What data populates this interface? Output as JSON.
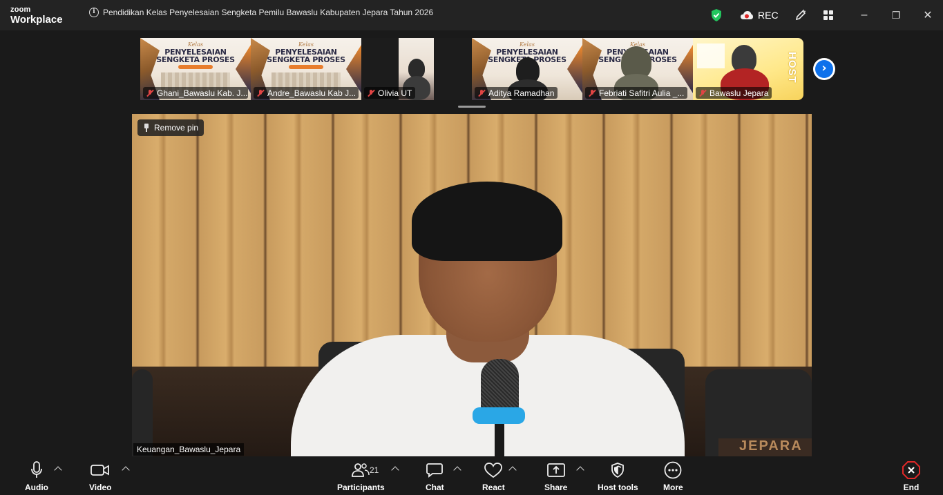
{
  "app": {
    "logo_line1": "zoom",
    "logo_line2": "Workplace"
  },
  "window": {
    "title": "Pendidikan Kelas Penyelesaian Sengketa Pemilu Bawaslu Kabupaten Jepara Tahun 2026"
  },
  "titlebar": {
    "security_icon": "shield-check-icon",
    "rec_label": "REC",
    "minimize": "–",
    "restore": "❐",
    "close": "✕"
  },
  "slide": {
    "kelas": "Kelas",
    "title_line1": "PENYELESAIAN",
    "title_line2": "SENGKETA PROSES"
  },
  "thumbnails": [
    {
      "name": "Ghani_Bawaslu Kab. J...",
      "muted": true
    },
    {
      "name": "Andre_Bawaslu Kab J...",
      "muted": true
    },
    {
      "name": "Olivia UT",
      "muted": true
    },
    {
      "name": "Aditya Ramadhan",
      "muted": true
    },
    {
      "name": "Febriati Safitri Aulia _...",
      "muted": true
    },
    {
      "name": "Bawaslu Jepara",
      "muted": true,
      "badge": "HOST"
    }
  ],
  "pinned": {
    "remove_pin_label": "Remove pin",
    "participant_name": "Keuangan_Bawaslu_Jepara",
    "desk_sign": "JEPARA"
  },
  "toolbar": {
    "audio": "Audio",
    "video": "Video",
    "participants": "Participants",
    "participants_count": "21",
    "chat": "Chat",
    "react": "React",
    "share": "Share",
    "host_tools": "Host tools",
    "more": "More",
    "end": "End"
  },
  "colors": {
    "accent": "#0e71eb",
    "shield": "#23c55e",
    "end": "#e02828",
    "muted": "#e04444"
  }
}
